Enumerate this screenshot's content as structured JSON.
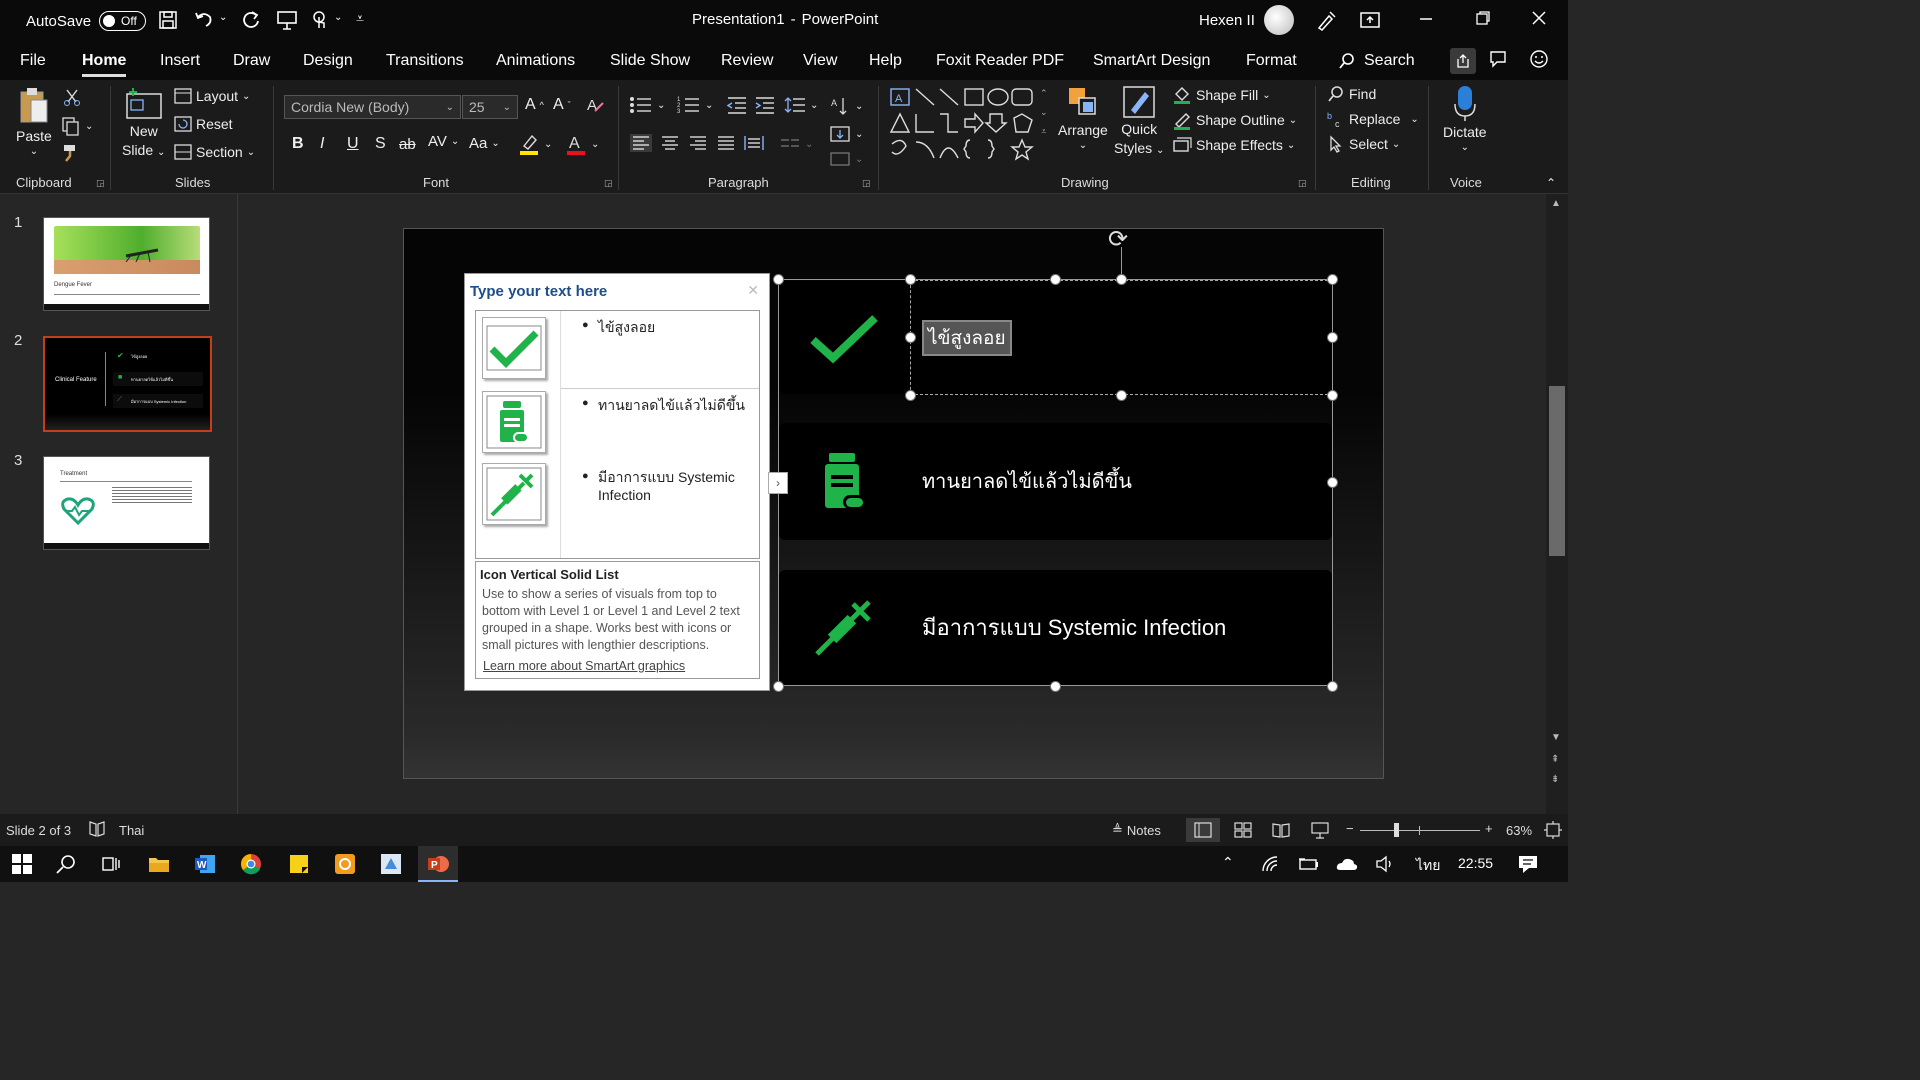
{
  "titlebar": {
    "autosave_label": "AutoSave",
    "autosave_state": "Off",
    "doc_title": "Presentation1",
    "separator": "-",
    "app_name": "PowerPoint",
    "user": "Hexen II"
  },
  "tabs": [
    "File",
    "Home",
    "Insert",
    "Draw",
    "Design",
    "Transitions",
    "Animations",
    "Slide Show",
    "Review",
    "View",
    "Help",
    "Foxit Reader PDF",
    "SmartArt Design",
    "Format"
  ],
  "search_label": "Search",
  "ribbon": {
    "clipboard": {
      "paste": "Paste",
      "label": "Clipboard"
    },
    "slides": {
      "new_slide_line1": "New",
      "new_slide_line2": "Slide",
      "layout": "Layout",
      "reset": "Reset",
      "section": "Section",
      "label": "Slides"
    },
    "font": {
      "font_name": "Cordia New (Body)",
      "font_size": "25",
      "bold": "B",
      "italic": "I",
      "underline": "U",
      "shadow": "S",
      "strike": "ab",
      "spacing": "AV",
      "case": "Aa",
      "label": "Font"
    },
    "paragraph": {
      "label": "Paragraph"
    },
    "drawing": {
      "arrange": "Arrange",
      "quick_line1": "Quick",
      "quick_line2": "Styles",
      "shape_fill": "Shape Fill",
      "shape_outline": "Shape Outline",
      "shape_effects": "Shape Effects",
      "label": "Drawing"
    },
    "editing": {
      "find": "Find",
      "replace": "Replace",
      "select": "Select",
      "label": "Editing"
    },
    "voice": {
      "dictate": "Dictate",
      "label": "Voice"
    }
  },
  "slides": [
    {
      "num": "1",
      "caption": "Dengue Fever"
    },
    {
      "num": "2",
      "title": "Clinical Feature",
      "items": [
        "ไข้สูงลอย",
        "ทานยาลดไข้แล้วไม่ดีขึ้น",
        "มีอาการแบบ Systemic Infection"
      ]
    },
    {
      "num": "3",
      "caption": "Treatment"
    }
  ],
  "text_pane": {
    "title": "Type your text here",
    "bullets": [
      "ไข้สูงลอย",
      "ทานยาลดไข้แล้วไม่ดีขึ้น",
      "มีอาการแบบ Systemic Infection"
    ],
    "info_title": "Icon Vertical Solid List",
    "info_desc": "Use to show a series of visuals from top to bottom with Level 1 or Level 1 and Level 2 text grouped in a shape. Works best with icons or small pictures with lengthier descriptions.",
    "link": "Learn more about SmartArt graphics"
  },
  "smartart": {
    "items": [
      "ไข้สูงลอย",
      "ทานยาลดไข้แล้วไม่ดีขึ้น",
      "มีอาการแบบ Systemic Infection"
    ]
  },
  "status": {
    "slide_info": "Slide 2 of 3",
    "language": "Thai",
    "notes": "Notes",
    "zoom": "63%"
  },
  "taskbar": {
    "lang": "ไทย",
    "time": "22:55"
  },
  "colors": {
    "accent_green": "#1fb34a",
    "ribbon_bg": "#1b1b1b",
    "selection": "#c43e1c"
  }
}
